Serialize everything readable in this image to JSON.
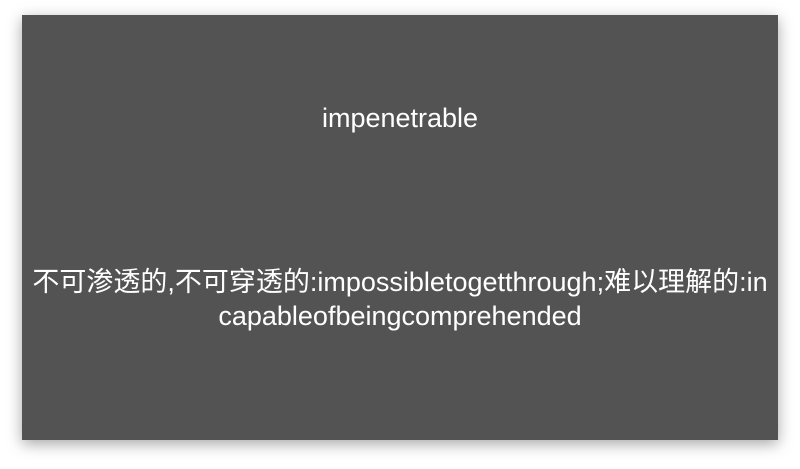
{
  "card": {
    "word": "impenetrable",
    "definition": "不可渗透的,不可穿透的:impossibletogetthrough;难以理解的:incapableofbeingcomprehended"
  }
}
